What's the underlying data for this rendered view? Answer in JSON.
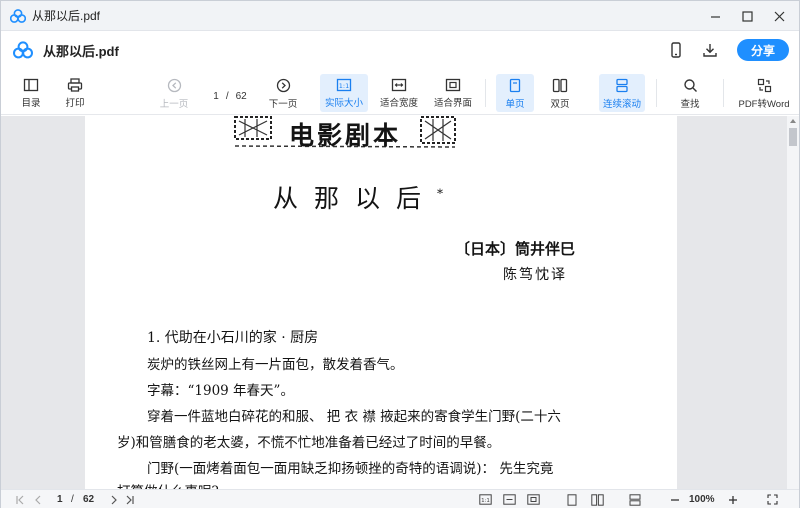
{
  "window": {
    "title": "从那以后.pdf"
  },
  "header": {
    "doc_title": "从那以后.pdf",
    "share_label": "分享"
  },
  "toolbar": {
    "toc": "目录",
    "print": "打印",
    "prev": "上一页",
    "current_page": "1",
    "sep": "/",
    "total_pages": "62",
    "next": "下一页",
    "actual_size": "实际大小",
    "fit_width": "适合宽度",
    "fit_page": "适合界面",
    "single_page": "单页",
    "double_page": "双页",
    "continuous": "连续滚动",
    "find": "查找",
    "pdf_to_word": "PDF转Word"
  },
  "document": {
    "banner": "电影剧本",
    "title": "从那以后",
    "title_mark": "*",
    "author": "〔日本〕筒井伴巳",
    "translator": "陈笃忱译",
    "paragraphs": [
      "1. 代助在小石川的家 · 厨房",
      "炭炉的铁丝网上有一片面包，散发着香气。",
      "字幕：“1909 年春天”。",
      "穿着一件蓝地白碎花的和服、 把 衣 襟 掖起来的寄食学生门野(二十六",
      "岁)和管膳食的老太婆，不慌不忙地准备着已经过了时间的早餐。",
      "门野(一面烤着面包一面用缺乏抑扬顿挫的奇特的语调说)： 先生究竟",
      "打算做什么事呢?"
    ]
  },
  "statusbar": {
    "current_page": "1",
    "sep": "/",
    "total_pages": "62",
    "zoom": "100%"
  },
  "colors": {
    "accent": "#1f8fff",
    "active_bg": "#e3effd",
    "active_text": "#1a7ff0"
  },
  "icons": [
    "app-logo-icon",
    "minimize-icon",
    "maximize-icon",
    "close-icon",
    "phone-icon",
    "download-icon",
    "toc-icon",
    "print-icon",
    "prev-page-icon",
    "next-page-icon",
    "actual-size-icon",
    "fit-width-icon",
    "fit-page-icon",
    "single-page-icon",
    "double-page-icon",
    "continuous-scroll-icon",
    "search-icon",
    "pdf-to-word-icon",
    "first-page-icon",
    "prev-icon",
    "next-icon",
    "last-page-icon",
    "zoom-out-icon",
    "zoom-in-icon",
    "fullscreen-icon"
  ]
}
